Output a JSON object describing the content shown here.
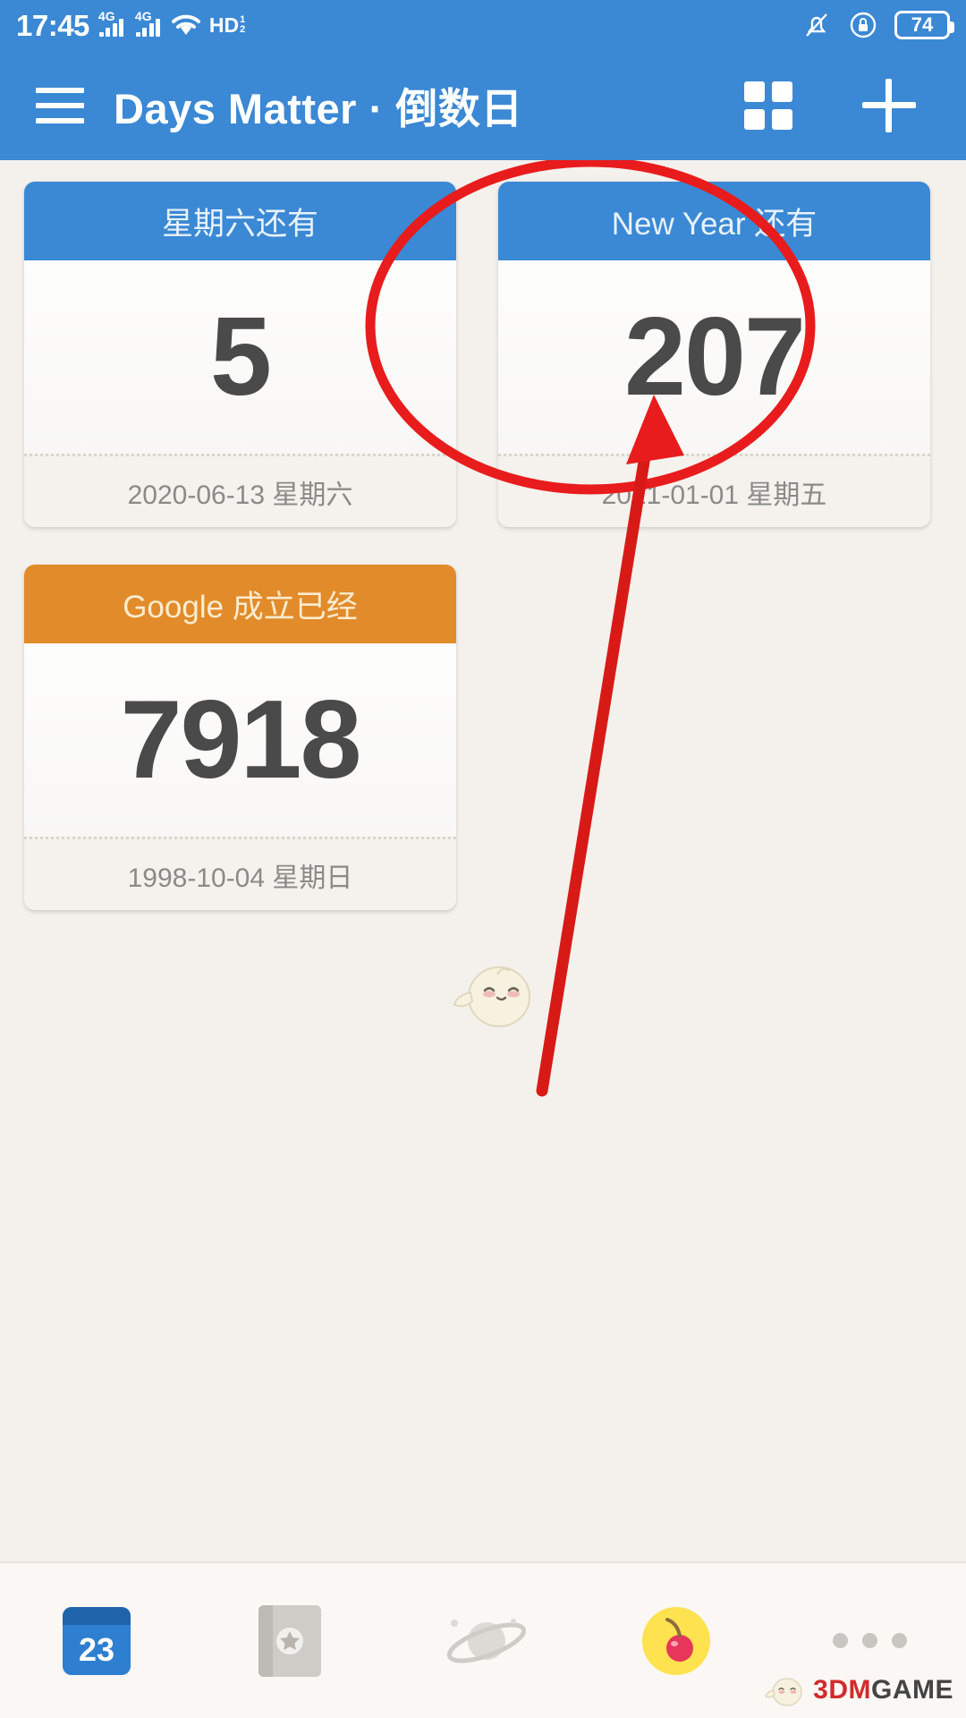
{
  "status_bar": {
    "time": "17:45",
    "network_1": "4G",
    "network_2": "4G",
    "wifi": "wifi-icon",
    "hd_label": "HD",
    "hd_sup_top": "1",
    "hd_sup_bottom": "2",
    "silent": "bell-muted-icon",
    "rotation_lock": "rotation-lock-icon",
    "battery_level": "74",
    "bar_color": "#3b88d4"
  },
  "app_bar": {
    "menu_icon": "hamburger-menu-icon",
    "title": "Days Matter · 倒数日",
    "grid_icon": "grid-view-icon",
    "add_icon": "plus-add-icon",
    "background": "#3b88d4"
  },
  "cards": [
    {
      "title": "星期六还有",
      "days": "5",
      "date": "2020-06-13 星期六",
      "header_color": "#3b88d4",
      "accent": "blue"
    },
    {
      "title": "New Year 还有",
      "days": "207",
      "date": "2021-01-01 星期五",
      "header_color": "#3b88d4",
      "accent": "blue"
    },
    {
      "title": "Google 成立已经",
      "days": "7918",
      "date": "1998-10-04 星期日",
      "header_color": "#e28b2b",
      "accent": "orange"
    }
  ],
  "annotation": {
    "shape": "red-circle-highlight",
    "pointer": "red-arrow",
    "color": "#e81c1c",
    "target_card_index": 1
  },
  "bottom_bar": {
    "items": [
      {
        "icon": "calendar-icon",
        "badge": "23"
      },
      {
        "icon": "notebook-star-icon"
      },
      {
        "icon": "planet-icon"
      },
      {
        "icon": "cherry-icon"
      },
      {
        "icon": "more-dots-icon"
      }
    ]
  },
  "watermark": {
    "prefix": "3DM",
    "suffix": "GAME",
    "mascot": "chick-mascot-icon"
  }
}
